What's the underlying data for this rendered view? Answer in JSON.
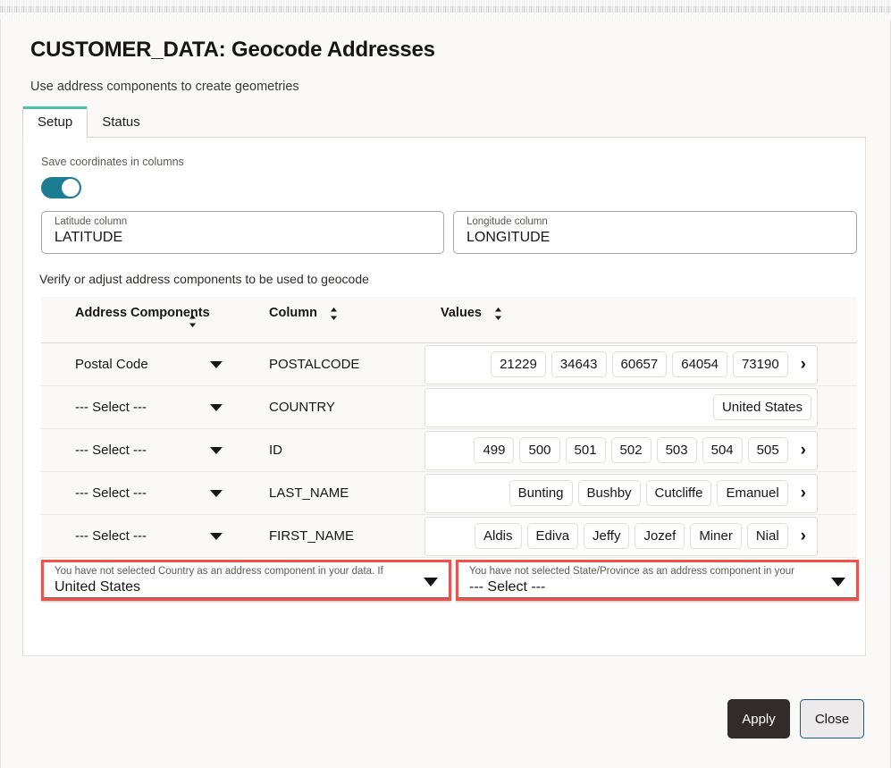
{
  "header": {
    "title": "CUSTOMER_DATA: Geocode Addresses",
    "subtitle": "Use address components to create geometries"
  },
  "tabs": [
    {
      "label": "Setup",
      "active": true
    },
    {
      "label": "Status",
      "active": false
    }
  ],
  "setup": {
    "save_coordinates_label": "Save coordinates in columns",
    "save_coordinates_toggle": "on",
    "latitude": {
      "label": "Latitude column",
      "value": "LATITUDE"
    },
    "longitude": {
      "label": "Longitude column",
      "value": "LONGITUDE"
    },
    "verify_text": "Verify or adjust address components to be used to geocode",
    "table": {
      "headers": [
        "Address Components",
        "Column",
        "Values"
      ],
      "rows": [
        {
          "address_component": "Postal Code",
          "column": "POSTALCODE",
          "values": [
            "21229",
            "34643",
            "60657",
            "64054",
            "73190"
          ],
          "has_next": true
        },
        {
          "address_component": "--- Select ---",
          "column": "COUNTRY",
          "values": [
            "United States"
          ],
          "has_next": false
        },
        {
          "address_component": "--- Select ---",
          "column": "ID",
          "values": [
            "499",
            "500",
            "501",
            "502",
            "503",
            "504",
            "505"
          ],
          "has_next": true
        },
        {
          "address_component": "--- Select ---",
          "column": "LAST_NAME",
          "values": [
            "Bunting",
            "Bushby",
            "Cutcliffe",
            "Emanuel"
          ],
          "has_next": true
        },
        {
          "address_component": "--- Select ---",
          "column": "FIRST_NAME",
          "values": [
            "Aldis",
            "Ediva",
            "Jeffy",
            "Jozef",
            "Miner",
            "Nial"
          ],
          "has_next": true
        }
      ]
    },
    "country_select": {
      "label": "You have not selected Country as an address component in your data. If",
      "value": "United States",
      "highlighted": true
    },
    "state_select": {
      "label": "You have not selected State/Province as an address component in your",
      "value": "--- Select ---",
      "highlighted": true
    }
  },
  "footer": {
    "apply_label": "Apply",
    "close_label": "Close"
  },
  "colors": {
    "accent_tab": "#4ec2a4",
    "toggle_on": "#1c7c92",
    "highlight_border": "#f4504a",
    "apply_bg": "#312c29",
    "close_border": "#1a5a7a"
  }
}
